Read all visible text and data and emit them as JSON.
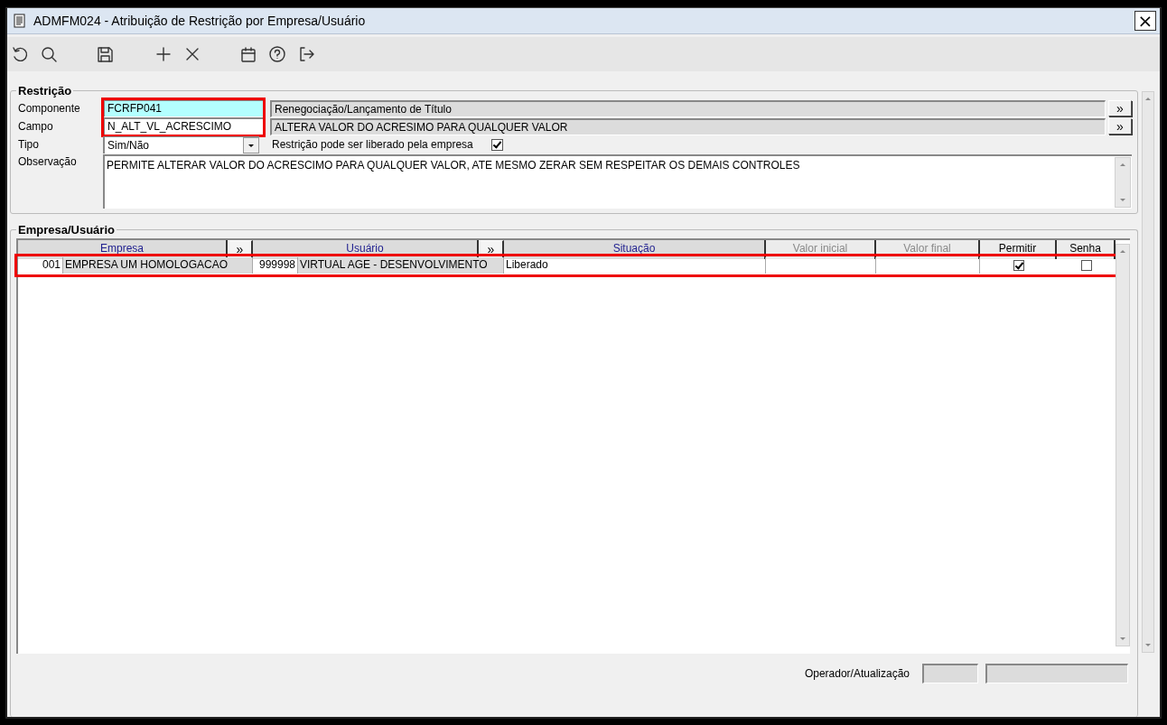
{
  "window": {
    "title": "ADMFM024 - Atribuição de Restrição por Empresa/Usuário",
    "close": "×"
  },
  "restricao": {
    "title": "Restrição",
    "highlighted": true,
    "componente": {
      "label": "Componente",
      "code": "FCRFP041",
      "description": "Renegociação/Lançamento de Título",
      "button": "»"
    },
    "campo": {
      "label": "Campo",
      "code": "N_ALT_VL_ACRESCIMO",
      "description": "ALTERA VALOR DO ACRESIMO PARA QUALQUER VALOR",
      "button": "»"
    },
    "tipo": {
      "label": "Tipo",
      "value": "Sim/Não"
    },
    "liberado": {
      "label": "Restrição pode ser liberado pela empresa",
      "checked": true
    },
    "observacao": {
      "label": "Observação",
      "value": "PERMITE ALTERAR VALOR DO ACRESCIMO PARA QUALQUER VALOR, ATE MESMO ZERAR SEM RESPEITAR OS DEMAIS CONTROLES"
    }
  },
  "empresa_usuario": {
    "title": "Empresa/Usuário",
    "columns": [
      {
        "label": "Empresa",
        "kind": "lookup"
      },
      {
        "label": "»",
        "kind": "action"
      },
      {
        "label": "Usuário",
        "kind": "lookup"
      },
      {
        "label": "»",
        "kind": "action"
      },
      {
        "label": "Situação",
        "kind": "combo"
      },
      {
        "label": "Valor inicial",
        "kind": "disabled"
      },
      {
        "label": "Valor final",
        "kind": "disabled"
      },
      {
        "label": "Permitir",
        "kind": "check"
      },
      {
        "label": "Senha",
        "kind": "check"
      }
    ],
    "rows": [
      {
        "highlighted": true,
        "empresa_code": "001",
        "empresa_name": "EMPRESA UM HOMOLOGACAO",
        "usuario_code": "999998",
        "usuario_name": "VIRTUAL AGE - DESENVOLVIMENTO",
        "situacao": "Liberado",
        "permitir": true,
        "senha": false
      }
    ]
  },
  "footer": {
    "label": "Operador/Atualização"
  }
}
